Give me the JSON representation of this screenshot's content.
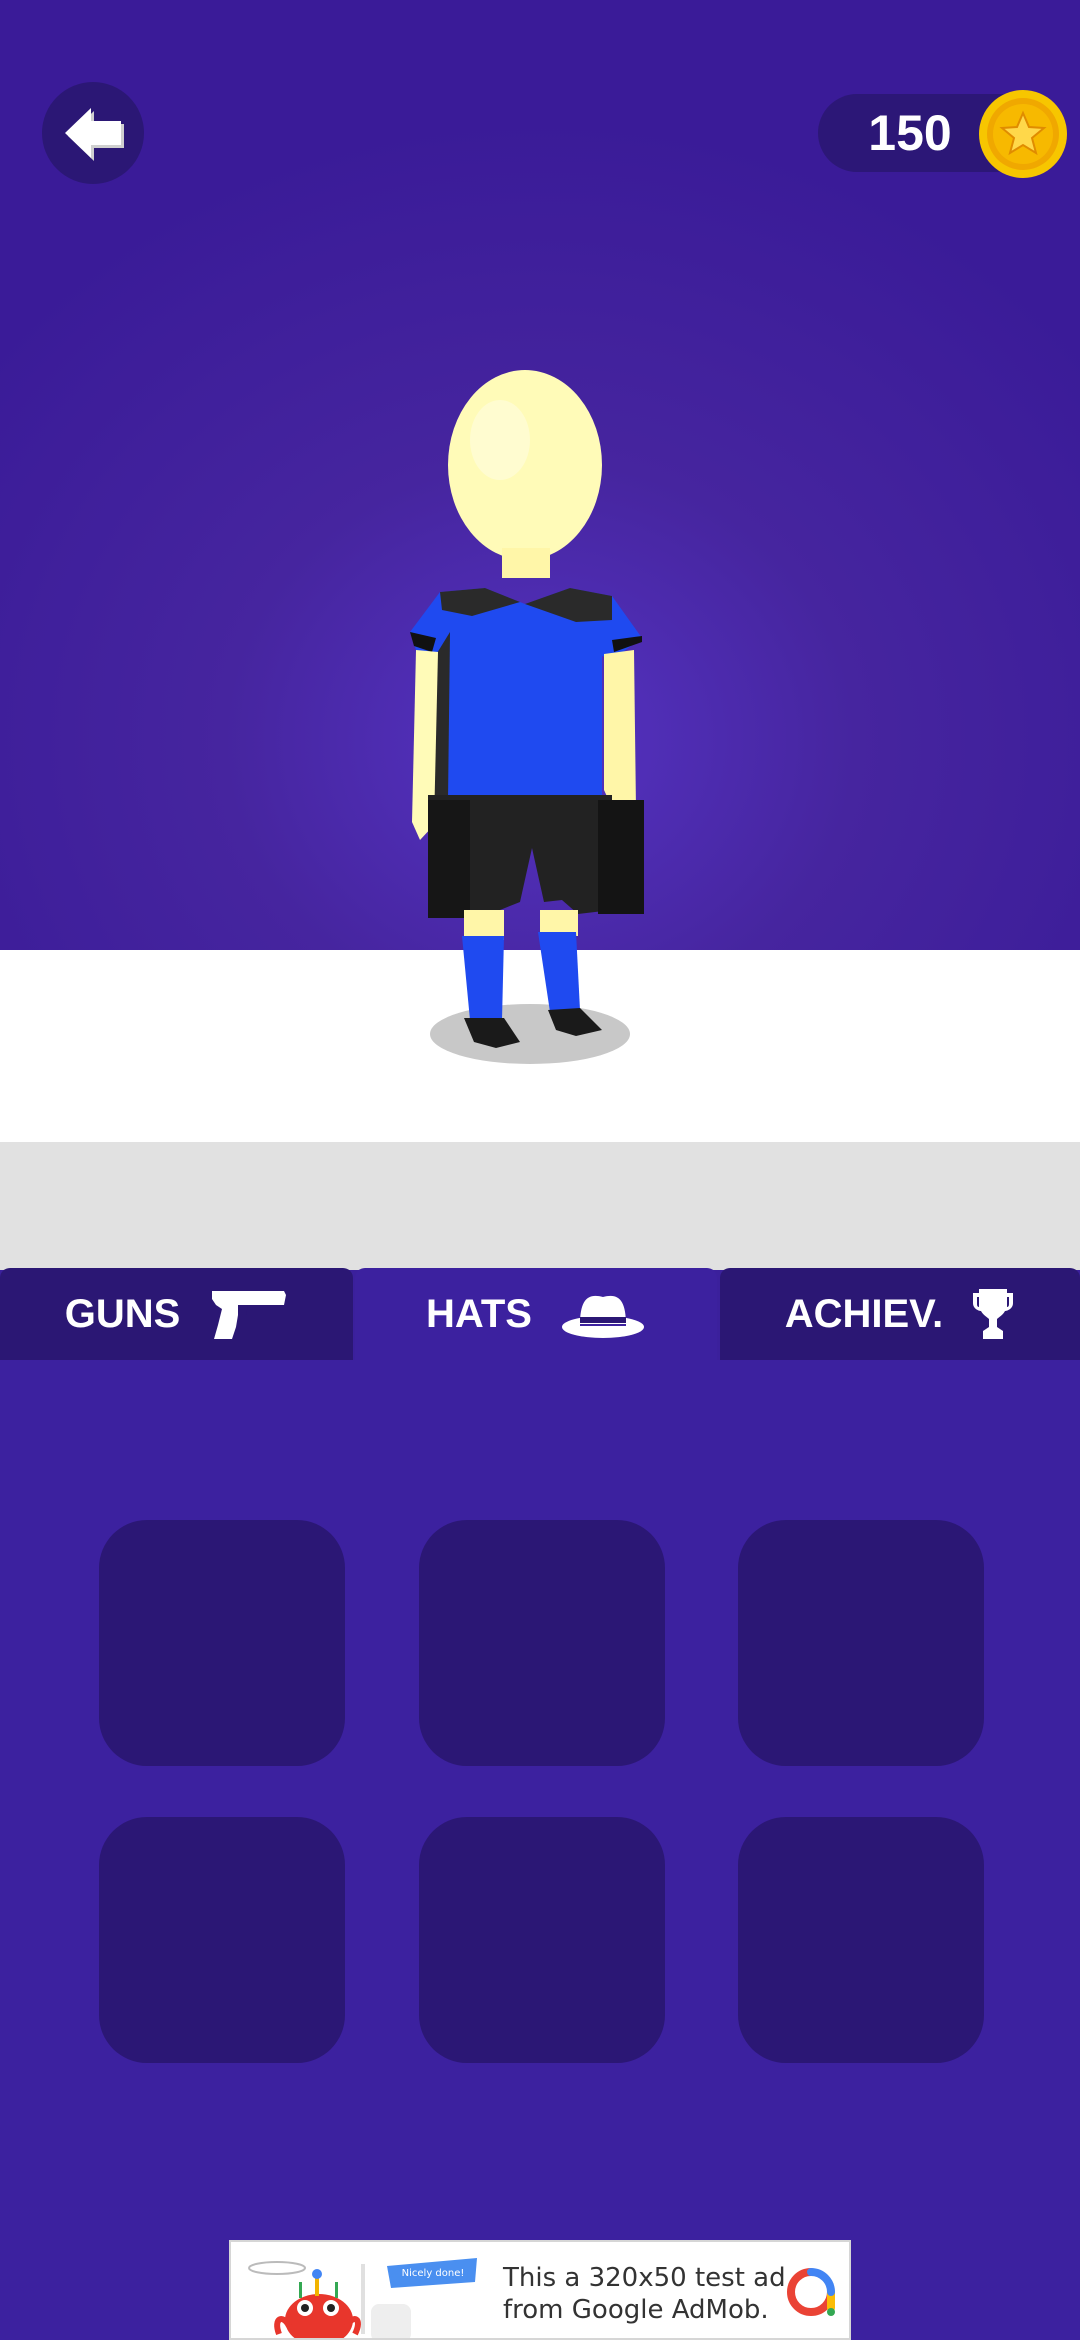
{
  "header": {
    "back_icon": "back-arrow-icon",
    "coins": "150",
    "coin_icon": "gold-star-coin-icon"
  },
  "tabs": [
    {
      "label": "GUNS",
      "icon": "pistol-icon",
      "active": false
    },
    {
      "label": "HATS",
      "icon": "fedora-hat-icon",
      "active": true
    },
    {
      "label": "ACHIEV.",
      "icon": "trophy-icon",
      "active": false
    }
  ],
  "item_slots": [
    "",
    "",
    "",
    "",
    "",
    ""
  ],
  "ad": {
    "line1": "This a 320x50 test ad",
    "line2": "from Google AdMob.",
    "badge": "Nicely done!",
    "logo_icon": "admob-logo-icon"
  },
  "colors": {
    "background": "#3b209c",
    "panel_dark": "#2b1775",
    "floor": "#ffffff",
    "coin": "#f5b800",
    "shirt": "#1f4af0"
  }
}
